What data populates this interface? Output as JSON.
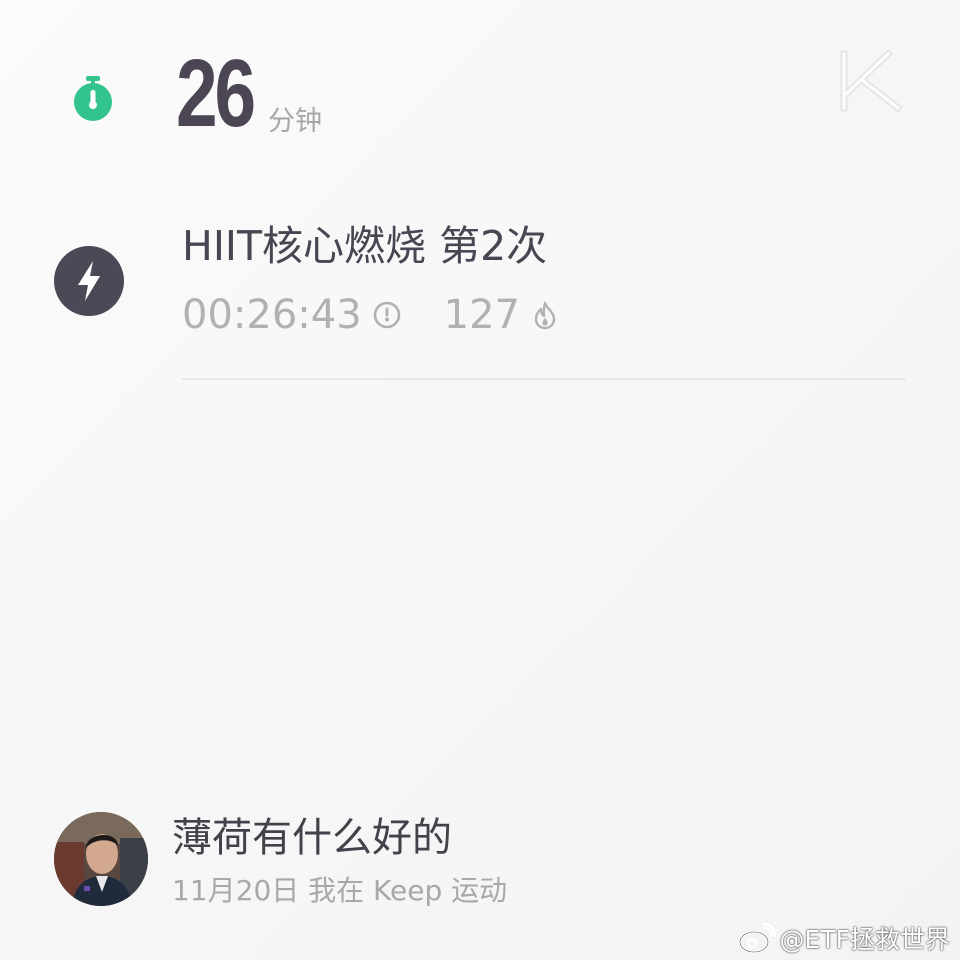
{
  "summary": {
    "duration_value": "26",
    "duration_unit": "分钟",
    "icon": "stopwatch-icon",
    "brand": "keep-logo-icon",
    "accent_color": "#33c38c"
  },
  "workout": {
    "icon": "lightning-bolt-icon",
    "title": "HIIT核心燃烧 第2次",
    "time": "00:26:43",
    "time_icon": "clock-icon",
    "calories": "127",
    "calories_icon": "flame-icon",
    "icon_bg_color": "#4d4856"
  },
  "user": {
    "name": "薄荷有什么好的",
    "share_text": "11月20日 我在 Keep 运动"
  },
  "watermark": {
    "icon": "weibo-icon",
    "text": "@ETF拯救世界"
  }
}
